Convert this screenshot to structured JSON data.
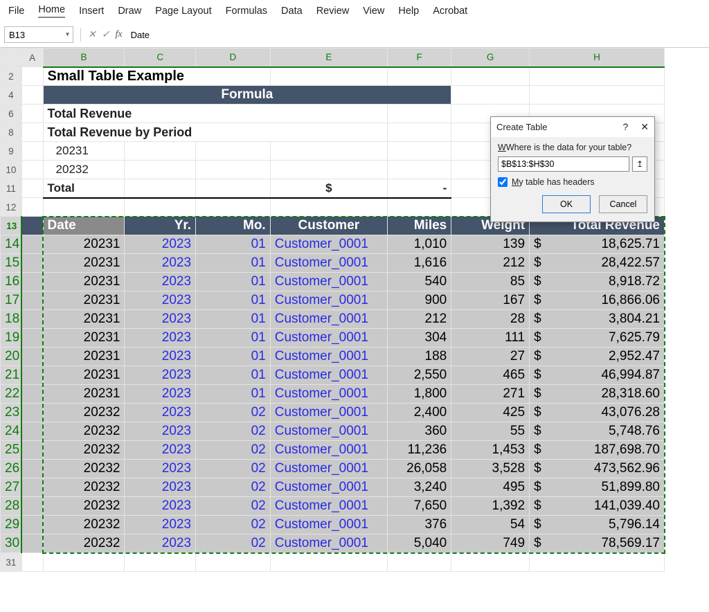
{
  "ribbon": {
    "tabs": [
      "File",
      "Home",
      "Insert",
      "Draw",
      "Page Layout",
      "Formulas",
      "Data",
      "Review",
      "View",
      "Help",
      "Acrobat"
    ],
    "active": "Home"
  },
  "fbar": {
    "namebox": "B13",
    "fx": "fx",
    "formula": "Date"
  },
  "columns": [
    "A",
    "B",
    "C",
    "D",
    "E",
    "F",
    "G",
    "H"
  ],
  "rows_before": [
    "2",
    "4",
    "6",
    "8",
    "9",
    "10",
    "11",
    "12"
  ],
  "top": {
    "title": "Small Table Example",
    "formula_band": "Formula",
    "total_rev": "Total Revenue",
    "total_rev_period": "Total Revenue by Period",
    "p1": "20231",
    "p2": "20232",
    "total_label": "Total",
    "dollar": "$",
    "dash": "-"
  },
  "headers": {
    "date": "Date",
    "yr": "Yr.",
    "mo": "Mo.",
    "cust": "Customer",
    "miles": "Miles",
    "weight": "Weight",
    "rev": "Total Revenue"
  },
  "data_rows": [
    {
      "n": "14",
      "date": "20231",
      "yr": "2023",
      "mo": "01",
      "cust": "Customer_0001",
      "miles": "1,010",
      "weight": "139",
      "rev": "18,625.71"
    },
    {
      "n": "15",
      "date": "20231",
      "yr": "2023",
      "mo": "01",
      "cust": "Customer_0001",
      "miles": "1,616",
      "weight": "212",
      "rev": "28,422.57"
    },
    {
      "n": "16",
      "date": "20231",
      "yr": "2023",
      "mo": "01",
      "cust": "Customer_0001",
      "miles": "540",
      "weight": "85",
      "rev": "8,918.72"
    },
    {
      "n": "17",
      "date": "20231",
      "yr": "2023",
      "mo": "01",
      "cust": "Customer_0001",
      "miles": "900",
      "weight": "167",
      "rev": "16,866.06"
    },
    {
      "n": "18",
      "date": "20231",
      "yr": "2023",
      "mo": "01",
      "cust": "Customer_0001",
      "miles": "212",
      "weight": "28",
      "rev": "3,804.21"
    },
    {
      "n": "19",
      "date": "20231",
      "yr": "2023",
      "mo": "01",
      "cust": "Customer_0001",
      "miles": "304",
      "weight": "111",
      "rev": "7,625.79"
    },
    {
      "n": "20",
      "date": "20231",
      "yr": "2023",
      "mo": "01",
      "cust": "Customer_0001",
      "miles": "188",
      "weight": "27",
      "rev": "2,952.47"
    },
    {
      "n": "21",
      "date": "20231",
      "yr": "2023",
      "mo": "01",
      "cust": "Customer_0001",
      "miles": "2,550",
      "weight": "465",
      "rev": "46,994.87"
    },
    {
      "n": "22",
      "date": "20231",
      "yr": "2023",
      "mo": "01",
      "cust": "Customer_0001",
      "miles": "1,800",
      "weight": "271",
      "rev": "28,318.60"
    },
    {
      "n": "23",
      "date": "20232",
      "yr": "2023",
      "mo": "02",
      "cust": "Customer_0001",
      "miles": "2,400",
      "weight": "425",
      "rev": "43,076.28"
    },
    {
      "n": "24",
      "date": "20232",
      "yr": "2023",
      "mo": "02",
      "cust": "Customer_0001",
      "miles": "360",
      "weight": "55",
      "rev": "5,748.76"
    },
    {
      "n": "25",
      "date": "20232",
      "yr": "2023",
      "mo": "02",
      "cust": "Customer_0001",
      "miles": "11,236",
      "weight": "1,453",
      "rev": "187,698.70"
    },
    {
      "n": "26",
      "date": "20232",
      "yr": "2023",
      "mo": "02",
      "cust": "Customer_0001",
      "miles": "26,058",
      "weight": "3,528",
      "rev": "473,562.96"
    },
    {
      "n": "27",
      "date": "20232",
      "yr": "2023",
      "mo": "02",
      "cust": "Customer_0001",
      "miles": "3,240",
      "weight": "495",
      "rev": "51,899.80"
    },
    {
      "n": "28",
      "date": "20232",
      "yr": "2023",
      "mo": "02",
      "cust": "Customer_0001",
      "miles": "7,650",
      "weight": "1,392",
      "rev": "141,039.40"
    },
    {
      "n": "29",
      "date": "20232",
      "yr": "2023",
      "mo": "02",
      "cust": "Customer_0001",
      "miles": "376",
      "weight": "54",
      "rev": "5,796.14"
    },
    {
      "n": "30",
      "date": "20232",
      "yr": "2023",
      "mo": "02",
      "cust": "Customer_0001",
      "miles": "5,040",
      "weight": "749",
      "rev": "78,569.17"
    }
  ],
  "row_after": "31",
  "dialog": {
    "title": "Create Table",
    "help": "?",
    "close": "✕",
    "prompt": "Where is the data for your table?",
    "range": "$B$13:$H$30",
    "picker": "↥",
    "checkbox_label_pre": "M",
    "checkbox_label_rest": "y table has headers",
    "ok": "OK",
    "cancel": "Cancel"
  }
}
